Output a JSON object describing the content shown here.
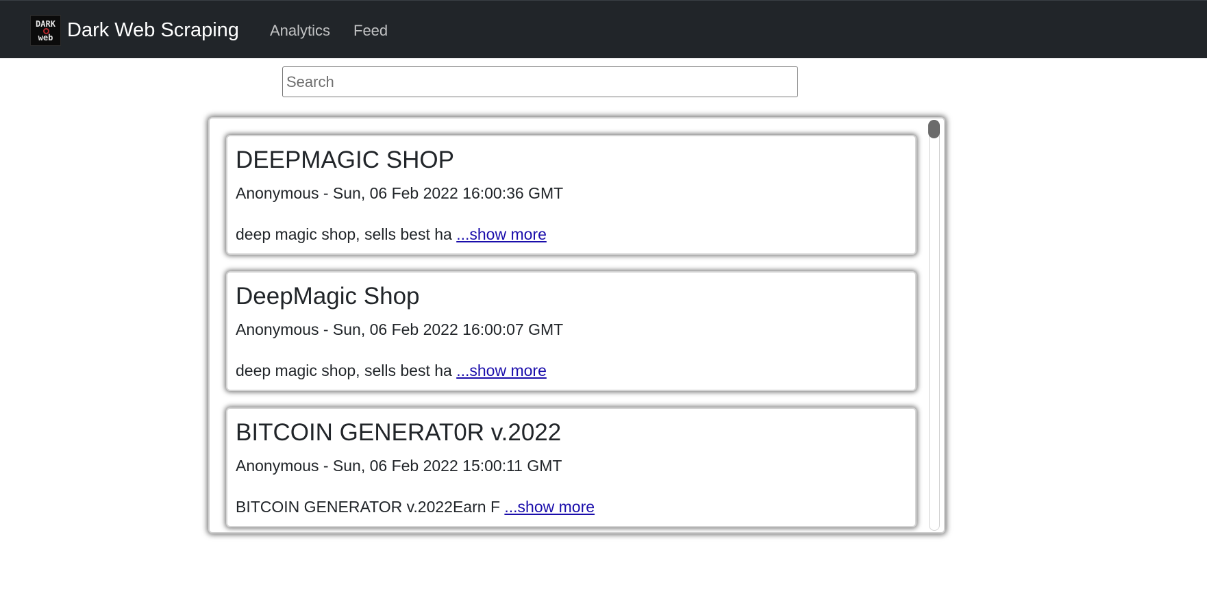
{
  "navbar": {
    "logo_line1": "DARK",
    "logo_line2": "web",
    "brand": "Dark Web Scraping",
    "links": [
      "Analytics",
      "Feed"
    ]
  },
  "search": {
    "placeholder": "Search",
    "value": ""
  },
  "feed": {
    "show_more_label": "...show more",
    "posts": [
      {
        "title": "DEEPMAGIC SHOP",
        "meta": "Anonymous - Sun, 06 Feb 2022 16:00:36 GMT",
        "snippet": "deep magic shop, sells best ha"
      },
      {
        "title": "DeepMagic Shop",
        "meta": "Anonymous - Sun, 06 Feb 2022 16:00:07 GMT",
        "snippet": "deep magic shop, sells best ha"
      },
      {
        "title": "BITCOIN GENERAT0R v.2022",
        "meta": "Anonymous - Sun, 06 Feb 2022 15:00:11 GMT",
        "snippet": "BITCOIN GENERATOR v.2022Earn F"
      }
    ]
  },
  "colors": {
    "navbar_bg": "#212529",
    "link_color": "#1a0dab"
  }
}
